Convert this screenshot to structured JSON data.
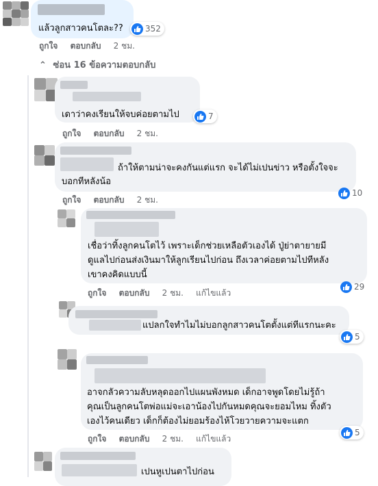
{
  "actions": {
    "like_label": "ถูกใจ",
    "reply_label": "ตอบกลับ",
    "edited_label": "แก้ไขแล้ว"
  },
  "top_comment": {
    "text": "แล้วลูกสาวคนโตละ??",
    "like_count": "352",
    "time": "2 ชม."
  },
  "hide_replies": {
    "arrow": "⌃",
    "label": "ซ่อน 16 ข้อความตอบกลับ"
  },
  "replies": [
    {
      "lines": [
        "เดาว่าคงเรียนให้จบค่อยตามไป"
      ],
      "like_count": "7",
      "time": "2 ชม."
    },
    {
      "lines": [
        "ถ้าให้ตามน่าจะคงกันแต่แรก จะได้ไม่เปนข่าว หรือตั้งใจจะ",
        "บอกทีหลังน้อ"
      ],
      "like_count": "10",
      "time": "2 ชม."
    },
    {
      "lines": [
        "เชื่อว่าทิ้งลูกคนโตไว้ เพราะเด็กช่วยเหลือตัวเองได้ ปู่ย่าตายายมี",
        "ดูแลไปก่อนส่งเงินมาให้ลูกเรียนไปก่อน ถึงเวลาค่อยตามไปทีหลัง",
        "เขาคงคิดแบบนี้"
      ],
      "like_count": "29",
      "time": "2 ชม."
    },
    {
      "lines": [
        "แปลกใจทำไมไม่บอกลูกสาวคนโตตั้งแต่ทีแรกนะคะ"
      ],
      "like_count": "5",
      "time": ""
    },
    {
      "lines": [
        "อาจกลัวความลับหลุดออกไปแผนพังหมด เด็กอาจพูดโดยไม่รู้ถ้า",
        "คุณเป็นลูกคนโตพ่อแม่จะเอาน้องไปกันหมดคุณจะยอมไหม ทิ้งตัว",
        "เองไว้คนเดียว เด็กก็ต้องไม่ยอมร้องไห้โวยวายความจะแตก"
      ],
      "like_count": "5",
      "time": "2 ชม."
    },
    {
      "lines": [
        "เปนหูเปนตาไปก่อน"
      ]
    }
  ]
}
